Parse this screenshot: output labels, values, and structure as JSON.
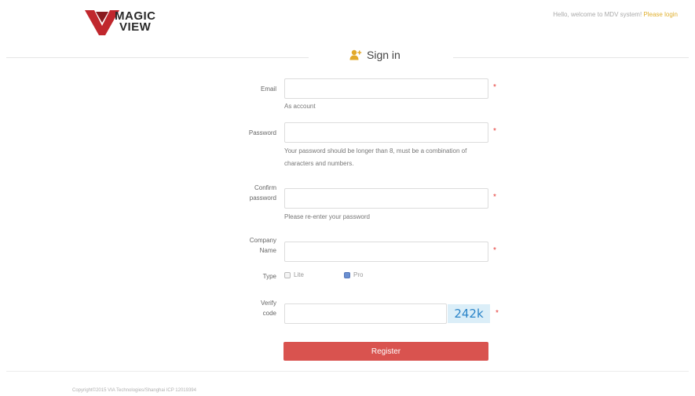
{
  "header": {
    "logo_line1": "MAGIC",
    "logo_line2": "VIEW",
    "logo_tm": "®",
    "welcome_text": "Hello, welcome to MDV system! ",
    "login_link": "Please login"
  },
  "title": {
    "icon": "add-user-icon",
    "text": "Sign in"
  },
  "form": {
    "email": {
      "label": "Email",
      "value": "",
      "hint": "As account",
      "required_mark": "*"
    },
    "password": {
      "label": "Password",
      "value": "",
      "hint": "Your password should be longer than 8, must be a combination of characters and numbers.",
      "required_mark": "*"
    },
    "confirm_password": {
      "label_line1": "Confirm",
      "label_line2": "password",
      "value": "",
      "hint": "Please re-enter your password",
      "required_mark": "*"
    },
    "company_name": {
      "label_line1": "Company",
      "label_line2": "Name",
      "value": "",
      "required_mark": "*"
    },
    "type": {
      "label": "Type",
      "options": [
        {
          "label": "Lite",
          "checked": false
        },
        {
          "label": "Pro",
          "checked": true
        }
      ]
    },
    "verify_code": {
      "label_line1": "Verify",
      "label_line2": "code",
      "value": "",
      "captcha": "242k",
      "required_mark": "*"
    },
    "register_label": "Register"
  },
  "footer": {
    "copyright": "Copyright©2015 VIA Technologies/Shanghai ICP 12019394"
  },
  "colors": {
    "accent_gold": "#e0b030",
    "register_red": "#d9534f",
    "required_red": "#e53935",
    "captcha_bg": "#dbeef8",
    "captcha_text": "#2a84c8"
  }
}
